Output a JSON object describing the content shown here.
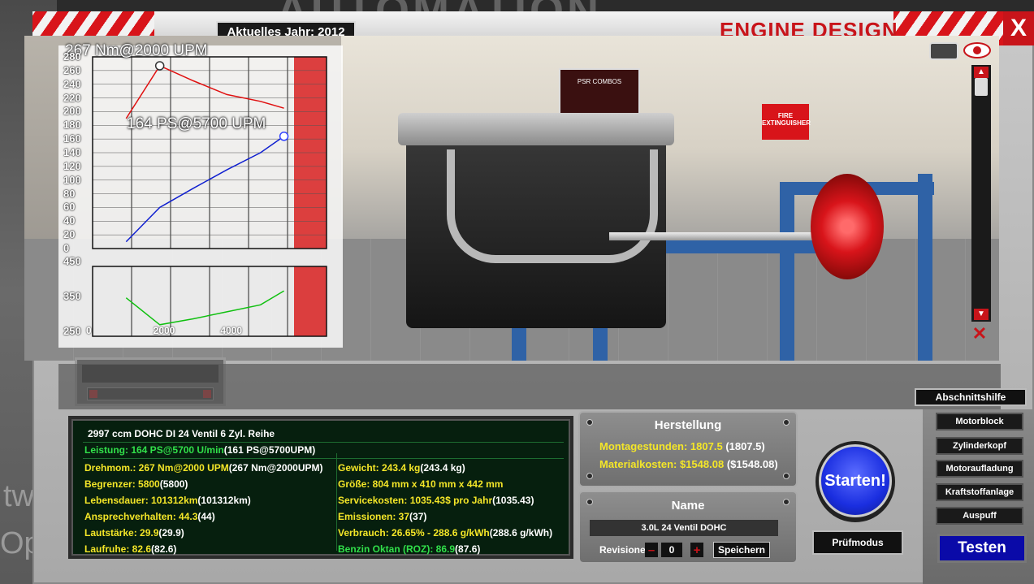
{
  "window": {
    "year_label": "Aktuelles Jahr: 2012",
    "title": "ENGINE DESIGN",
    "close_label": "X"
  },
  "background": {
    "logo_text": "AUTOMATION",
    "left_text_1": "tw",
    "left_text_2": "Op"
  },
  "viewport": {
    "sign_text": "FIRE EXTINGUISHER",
    "poster_text": "PSR COMBOS"
  },
  "chart": {
    "torque_label": "267 Nm@2000 UPM",
    "power_label": "164 PS@5700 UPM",
    "yticks_top": [
      "280",
      "260",
      "240",
      "220",
      "200",
      "180",
      "160",
      "140",
      "120",
      "100",
      "80",
      "60",
      "40",
      "20",
      "0"
    ],
    "yticks_bottom": [
      "450",
      "350",
      "250"
    ],
    "xticks": [
      "0",
      "2000",
      "4000"
    ],
    "colors": {
      "torque": "#e01010",
      "power": "#1020d0",
      "consumption": "#10c010",
      "redline": "#d82020"
    }
  },
  "chart_data": {
    "type": "line",
    "title": "",
    "x": [
      1000,
      2000,
      3000,
      4000,
      5000,
      5700
    ],
    "xlabel": "",
    "ylabel": "",
    "series": [
      {
        "name": "",
        "values": [
          190,
          267,
          245,
          225,
          215,
          205
        ]
      },
      {
        "name": "",
        "values": [
          10,
          60,
          88,
          115,
          140,
          164
        ]
      },
      {
        "name": "",
        "values": [
          360,
          283,
          300,
          320,
          340,
          380
        ]
      }
    ],
    "ylim_top": [
      0,
      280
    ],
    "ylim_bottom": [
      250,
      450
    ],
    "xlim": [
      0,
      6000
    ],
    "grid": true
  },
  "stats": {
    "header": "2997 ccm DOHC DI 24 Ventil 6 Zyl. Reihe",
    "rows": [
      {
        "label": "Leistung: 164 PS@5700 U/min",
        "extra": " (161 PS@5700UPM)"
      },
      {
        "label": "Drehmom.: 267 Nm@2000 UPM",
        "extra": " (267 Nm@2000UPM)"
      },
      {
        "label": "Begrenzer: 5800",
        "extra": " (5800)"
      },
      {
        "label": "Lebensdauer: 101312km",
        "extra": " (101312km)"
      },
      {
        "label": "Ansprechverhalten: 44.3",
        "extra": " (44)"
      },
      {
        "label": "Lautstärke: 29.9",
        "extra": " (29.9)"
      },
      {
        "label": "Laufruhe: 82.6",
        "extra": " (82.6)"
      },
      {
        "label": "Gewicht: 243.4 kg",
        "extra": " (243.4 kg)"
      },
      {
        "label": "Größe: 804 mm x 410 mm x 442 mm",
        "extra": ""
      },
      {
        "label": "Servicekosten: 1035.43$ pro Jahr",
        "extra": " (1035.43)"
      },
      {
        "label": "Emissionen: 37",
        "extra": " (37)"
      },
      {
        "label": "Verbrauch: 26.65% - 288.6 g/kWh",
        "extra": " (288.6 g/kWh)"
      },
      {
        "label": "Benzin Oktan (ROZ): 86.9",
        "extra": " (87.6)"
      }
    ]
  },
  "herstellung": {
    "title": "Herstellung",
    "montage_label": "Montagestunden: 1807.5",
    "montage_extra": " (1807.5)",
    "material_label": "Materialkosten: $1548.08",
    "material_extra": " ($1548.08)"
  },
  "name_panel": {
    "title": "Name",
    "value": "3.0L 24 Ventil DOHC",
    "revisions_label": "Revisionen",
    "revisions_value": "0",
    "minus": "–",
    "plus": "+",
    "save_label": "Speichern"
  },
  "actions": {
    "help_label": "Abschnittshilfe",
    "start_label": "Starten!",
    "pruef_label": "Prüfmodus",
    "test_label": "Testen"
  },
  "nav": {
    "items": [
      "Motorblock",
      "Zylinderkopf",
      "Motoraufladung",
      "Kraftstoffanlage",
      "Auspuff"
    ]
  }
}
